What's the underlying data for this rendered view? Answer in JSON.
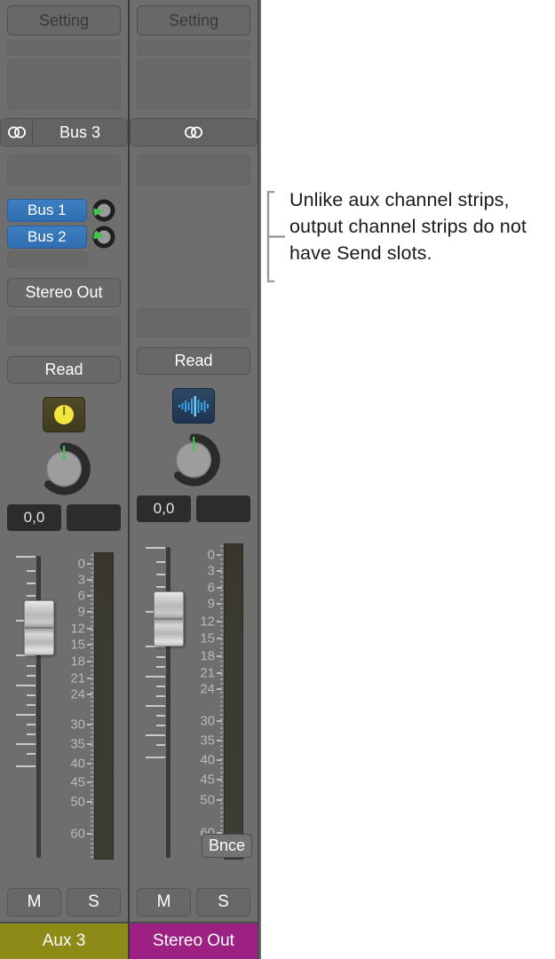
{
  "mixer": {
    "strips": [
      {
        "id": "aux-3",
        "setting_label": "Setting",
        "output_label": "Bus 3",
        "output_icon": "stereo-icon",
        "has_output_label": true,
        "sends": [
          {
            "label": "Bus 1",
            "knob_icon": "send-knob-icon"
          },
          {
            "label": "Bus 2",
            "knob_icon": "send-knob-icon"
          }
        ],
        "stereo_out_label": "Stereo Out",
        "automation_label": "Read",
        "plugin_icon": "metronome-icon",
        "plugin_icon_style": "yellow",
        "pan_knob_icon": "pan-knob-icon",
        "value_primary": "0,0",
        "value_secondary": "",
        "bounce_label": null,
        "mute_label": "M",
        "solo_label": "S",
        "name": "Aux 3",
        "name_color": "#8e8a18",
        "fader_value_marker": "fader-handle"
      },
      {
        "id": "stereo-out",
        "setting_label": "Setting",
        "output_label": "",
        "output_icon": "stereo-icon",
        "has_output_label": false,
        "sends": [],
        "stereo_out_label": "",
        "automation_label": "Read",
        "plugin_icon": "waveform-icon",
        "plugin_icon_style": "blue",
        "pan_knob_icon": "pan-knob-icon",
        "value_primary": "0,0",
        "value_secondary": "",
        "bounce_label": "Bnce",
        "mute_label": "M",
        "solo_label": "S",
        "name": "Stereo Out",
        "name_color": "#9c2182",
        "fader_value_marker": "fader-handle"
      }
    ],
    "meter_scale": [
      "0",
      "3",
      "6",
      "9",
      "12",
      "15",
      "18",
      "21",
      "24",
      "30",
      "35",
      "40",
      "45",
      "50",
      "60"
    ]
  },
  "callout": {
    "text": "Unlike aux channel strips, output channel strips do not have Send slots.",
    "bracket_icon": "bracket-icon"
  },
  "colors": {
    "panel": "#6e6e6e",
    "send_blue": "#3276bb",
    "aux_name": "#8e8a18",
    "output_name": "#9c2182",
    "meter_text": "#b9b9b9"
  }
}
